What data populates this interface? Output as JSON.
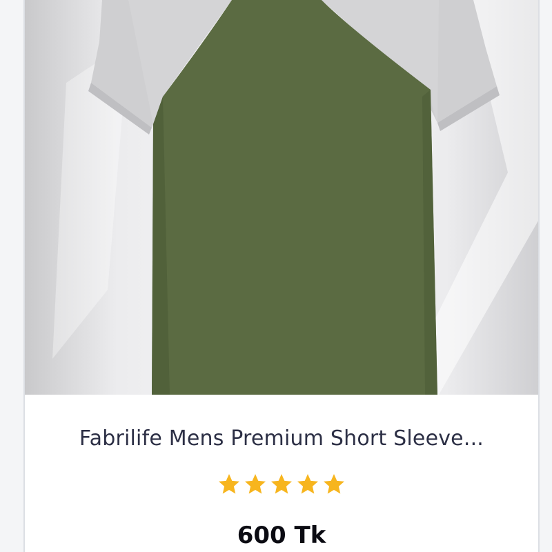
{
  "product": {
    "image_alt": "Olive green and grey raglan short sleeve t-shirt",
    "title": "Fabrilife Mens Premium Short Sleeve...",
    "rating": 5,
    "rating_max": 5,
    "price": "600 Tk"
  },
  "colors": {
    "shirt_body": "#5b6b42",
    "shirt_sleeve": "#cfcfd1",
    "star": "#f7b51e",
    "title_text": "#2c2f45",
    "price_text": "#0b0b12"
  }
}
